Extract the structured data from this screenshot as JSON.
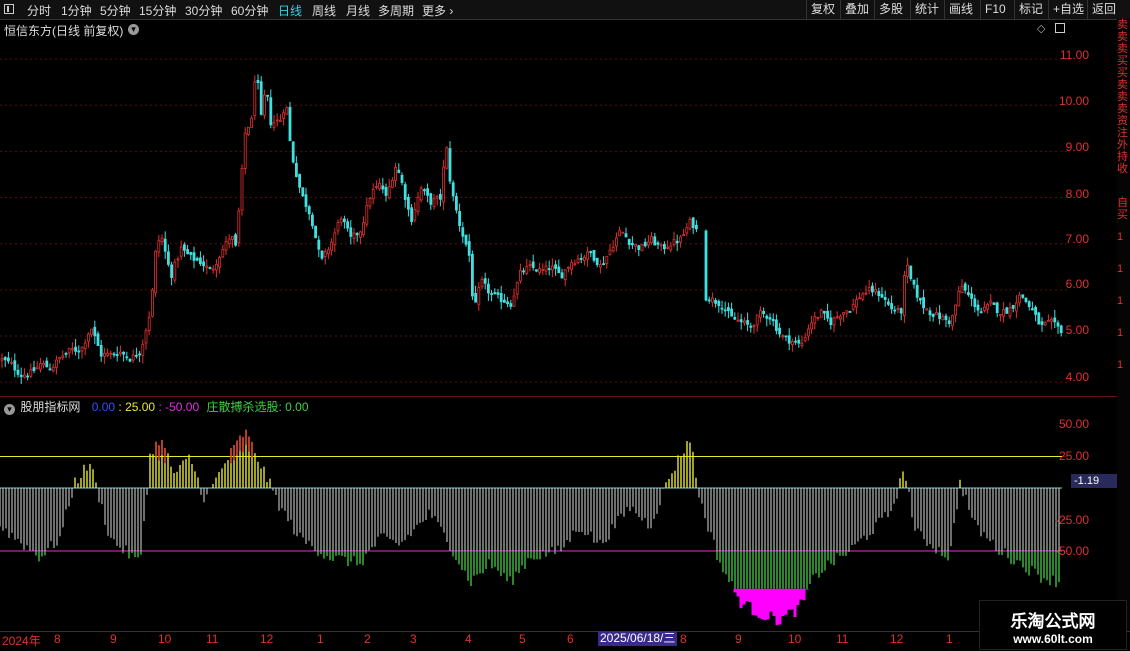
{
  "toolbar": {
    "periods": [
      "分时",
      "1分钟",
      "5分钟",
      "15分钟",
      "30分钟",
      "60分钟",
      "日线",
      "周线",
      "月线",
      "多周期",
      "更多"
    ],
    "active_period": "日线",
    "right_buttons": [
      "复权",
      "叠加",
      "多股",
      "统计",
      "画线",
      "F10",
      "标记",
      "+自选",
      "返回"
    ]
  },
  "main_chart": {
    "title": "恒信东方(日线 前复权)",
    "y_ticks": [
      "11.00",
      "10.00",
      "9.00",
      "8.00",
      "7.00",
      "6.00",
      "5.00",
      "4.00"
    ]
  },
  "indicator": {
    "name": "股朋指标网",
    "values": [
      {
        "text": "0.00",
        "color": "#3050ff"
      },
      {
        "text": ": 25.00",
        "color": "#e8e830"
      },
      {
        "text": ": -50.00",
        "color": "#e030e0"
      },
      {
        "text": "庄散搏杀选股: 0.00",
        "color": "#40d040"
      }
    ],
    "y_ticks": [
      "50.00",
      "25.00",
      "-25.00",
      "-50.00"
    ],
    "current_value": "-1.19"
  },
  "date_axis": {
    "labels": [
      "2024年",
      "8",
      "9",
      "10",
      "11",
      "12",
      "1",
      "2",
      "3",
      "4",
      "5",
      "6",
      "8",
      "9",
      "10",
      "11",
      "12",
      "1"
    ],
    "cursor_date": "2025/06/18/三"
  },
  "side_panel": {
    "chars": [
      "卖",
      "卖",
      "卖",
      "买",
      "买",
      "卖",
      "卖",
      "卖",
      "资",
      "注",
      "外",
      "持",
      "收",
      "自",
      "买",
      "1",
      "1",
      "1",
      "1",
      "1"
    ]
  },
  "watermark": {
    "line1": "乐淘公式网",
    "line2": "www.60lt.com"
  },
  "colors": {
    "up": "#e03030",
    "down": "#40e0e0",
    "line_25": "#e8e830",
    "line_m50": "#e030e0"
  },
  "chart_data": {
    "type": "candlestick",
    "title": "恒信东方(日线 前复权)",
    "ylim": [
      3.7,
      11.5
    ],
    "anchors": [
      [
        0,
        4.5
      ],
      [
        10,
        4.4
      ],
      [
        20,
        4.15
      ],
      [
        30,
        4.2
      ],
      [
        40,
        4.4
      ],
      [
        50,
        4.3
      ],
      [
        60,
        4.55
      ],
      [
        70,
        4.7
      ],
      [
        80,
        4.7
      ],
      [
        90,
        5.2
      ],
      [
        100,
        4.6
      ],
      [
        110,
        4.6
      ],
      [
        120,
        4.65
      ],
      [
        130,
        4.5
      ],
      [
        140,
        4.7
      ],
      [
        150,
        5.6
      ],
      [
        155,
        6.9
      ],
      [
        160,
        7.2
      ],
      [
        170,
        6.3
      ],
      [
        180,
        6.9
      ],
      [
        190,
        6.7
      ],
      [
        200,
        6.6
      ],
      [
        210,
        6.4
      ],
      [
        220,
        6.8
      ],
      [
        230,
        7.2
      ],
      [
        235,
        6.9
      ],
      [
        240,
        8.3
      ],
      [
        245,
        9.6
      ],
      [
        250,
        9.5
      ],
      [
        255,
        10.9
      ],
      [
        260,
        9.7
      ],
      [
        265,
        10.4
      ],
      [
        270,
        9.6
      ],
      [
        280,
        9.7
      ],
      [
        285,
        10.1
      ],
      [
        290,
        9.0
      ],
      [
        300,
        8.1
      ],
      [
        310,
        7.6
      ],
      [
        320,
        6.6
      ],
      [
        330,
        7.0
      ],
      [
        340,
        7.6
      ],
      [
        350,
        7.1
      ],
      [
        360,
        7.3
      ],
      [
        370,
        8.1
      ],
      [
        380,
        8.3
      ],
      [
        385,
        8.0
      ],
      [
        395,
        8.7
      ],
      [
        400,
        8.4
      ],
      [
        410,
        7.5
      ],
      [
        420,
        8.2
      ],
      [
        430,
        7.9
      ],
      [
        440,
        8.0
      ],
      [
        445,
        9.2
      ],
      [
        450,
        8.2
      ],
      [
        460,
        7.3
      ],
      [
        468,
        6.8
      ],
      [
        473,
        5.5
      ],
      [
        480,
        6.2
      ],
      [
        490,
        5.9
      ],
      [
        500,
        5.8
      ],
      [
        510,
        5.7
      ],
      [
        520,
        6.4
      ],
      [
        530,
        6.5
      ],
      [
        540,
        6.4
      ],
      [
        550,
        6.5
      ],
      [
        560,
        6.3
      ],
      [
        570,
        6.6
      ],
      [
        580,
        6.7
      ],
      [
        590,
        6.8
      ],
      [
        600,
        6.5
      ],
      [
        610,
        6.9
      ],
      [
        620,
        7.3
      ],
      [
        630,
        7.0
      ],
      [
        640,
        6.9
      ],
      [
        650,
        7.1
      ],
      [
        660,
        6.9
      ],
      [
        670,
        7.0
      ],
      [
        680,
        7.1
      ],
      [
        690,
        7.5
      ],
      [
        698,
        7.2
      ],
      [
        700,
        5.9
      ],
      [
        710,
        5.8
      ],
      [
        720,
        5.7
      ],
      [
        730,
        5.4
      ],
      [
        740,
        5.3
      ],
      [
        750,
        5.2
      ],
      [
        760,
        5.5
      ],
      [
        770,
        5.4
      ],
      [
        780,
        5.0
      ],
      [
        790,
        4.9
      ],
      [
        800,
        4.8
      ],
      [
        810,
        5.3
      ],
      [
        820,
        5.5
      ],
      [
        830,
        5.3
      ],
      [
        840,
        5.5
      ],
      [
        850,
        5.6
      ],
      [
        860,
        5.9
      ],
      [
        870,
        6.0
      ],
      [
        880,
        5.9
      ],
      [
        890,
        5.6
      ],
      [
        900,
        5.5
      ],
      [
        905,
        6.6
      ],
      [
        910,
        6.2
      ],
      [
        920,
        5.7
      ],
      [
        930,
        5.5
      ],
      [
        940,
        5.4
      ],
      [
        950,
        5.3
      ],
      [
        960,
        6.1
      ],
      [
        970,
        5.8
      ],
      [
        980,
        5.5
      ],
      [
        990,
        5.7
      ],
      [
        1000,
        5.5
      ],
      [
        1010,
        5.6
      ],
      [
        1020,
        5.9
      ],
      [
        1030,
        5.6
      ],
      [
        1040,
        5.2
      ],
      [
        1050,
        5.3
      ],
      [
        1062,
        5.1
      ]
    ],
    "gap_x_ranges": [
      [
        698,
        702
      ]
    ],
    "series_name": "恒信东方"
  }
}
